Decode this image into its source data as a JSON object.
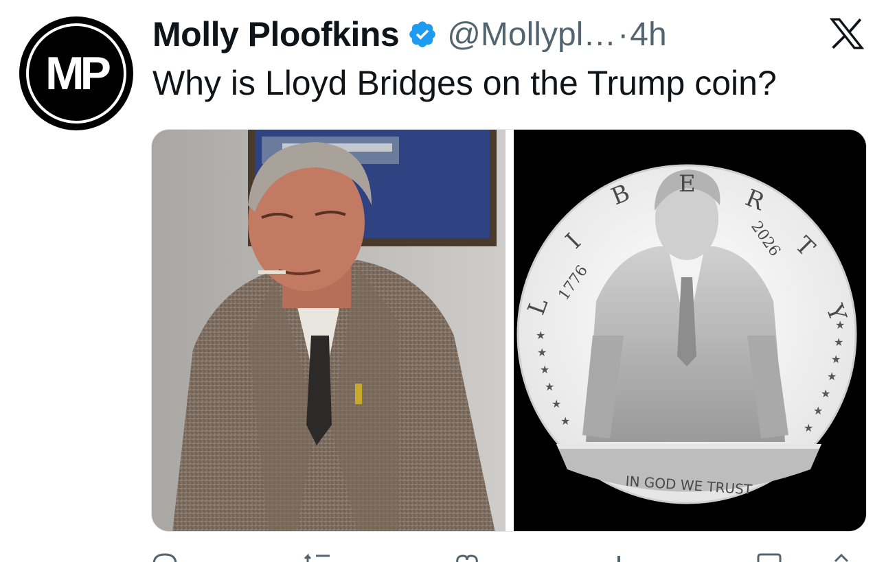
{
  "tweet": {
    "author": {
      "avatar_initials": "MP",
      "display_name": "Molly Ploofkins",
      "verified": true,
      "handle": "@Mollypl…",
      "separator": "·",
      "timestamp": "4h"
    },
    "text": "Why is Lloyd Bridges on the Trump coin?",
    "media": {
      "left_image": "man-in-tweed-jacket-photo",
      "right_image": "trump-coin-illustration",
      "coin": {
        "rim_text_letters": [
          "L",
          "I",
          "B",
          "E",
          "R",
          "T",
          "Y"
        ],
        "year_left": "1776",
        "year_right": "2026",
        "motto": "IN GOD WE TRUST"
      }
    },
    "actions": [
      "reply-icon",
      "repost-icon",
      "like-icon",
      "views-icon",
      "bookmark-icon",
      "share-icon"
    ]
  },
  "colors": {
    "text": "#0f1419",
    "secondary": "#536471",
    "verified_blue": "#1d9bf0",
    "background": "#ffffff"
  }
}
